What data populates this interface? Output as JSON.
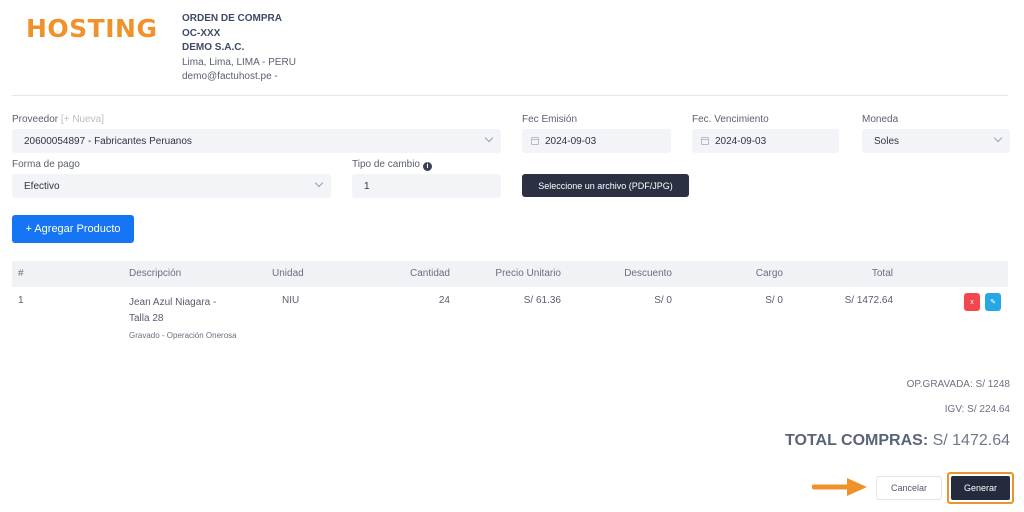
{
  "brand": {
    "logo_text": "HOSTING",
    "color": "#f0922b"
  },
  "company": {
    "doc_type": "ORDEN DE COMPRA",
    "doc_number": "OC-XXX",
    "name": "DEMO S.A.C.",
    "address": "Lima, Lima, LIMA - PERU",
    "email": "demo@factuhost.pe -"
  },
  "form": {
    "proveedor_label": "Proveedor",
    "proveedor_new": "[+ Nueva]",
    "proveedor_value": "20600054897 - Fabricantes Peruanos",
    "fec_emision_label": "Fec Emisión",
    "fec_emision_value": "2024-09-03",
    "fec_venc_label": "Fec. Vencimiento",
    "fec_venc_value": "2024-09-03",
    "moneda_label": "Moneda",
    "moneda_value": "Soles",
    "forma_pago_label": "Forma de pago",
    "forma_pago_value": "Efectivo",
    "tipo_cambio_label": "Tipo de cambio",
    "tipo_cambio_value": "1",
    "file_button": "Seleccione un archivo (PDF/JPG)",
    "add_product_button": "+ Agregar Producto"
  },
  "table": {
    "headers": {
      "num": "#",
      "descripcion": "Descripción",
      "unidad": "Unidad",
      "cantidad": "Cantidad",
      "precio": "Precio Unitario",
      "descuento": "Descuento",
      "cargo": "Cargo",
      "total": "Total"
    },
    "rows": [
      {
        "num": "1",
        "descripcion": "Jean Azul Niagara - Talla 28",
        "detalle": "Gravado - Operación Onerosa",
        "unidad": "NIU",
        "cantidad": "24",
        "precio": "S/ 61.36",
        "descuento": "S/ 0",
        "cargo": "S/ 0",
        "total": "S/ 1472.64",
        "delete_label": "x",
        "edit_label": "✎"
      }
    ]
  },
  "summary": {
    "op_gravada": "OP.GRAVADA: S/ 1248",
    "igv": "IGV: S/ 224.64",
    "total_label": "TOTAL COMPRAS:",
    "total_value": "S/ 1472.64"
  },
  "actions": {
    "cancel": "Cancelar",
    "generate": "Generar"
  },
  "colors": {
    "primary": "#1675f5",
    "dark": "#252a3d",
    "danger": "#f2474e",
    "info": "#26a8e6",
    "highlight": "#f0922b"
  }
}
